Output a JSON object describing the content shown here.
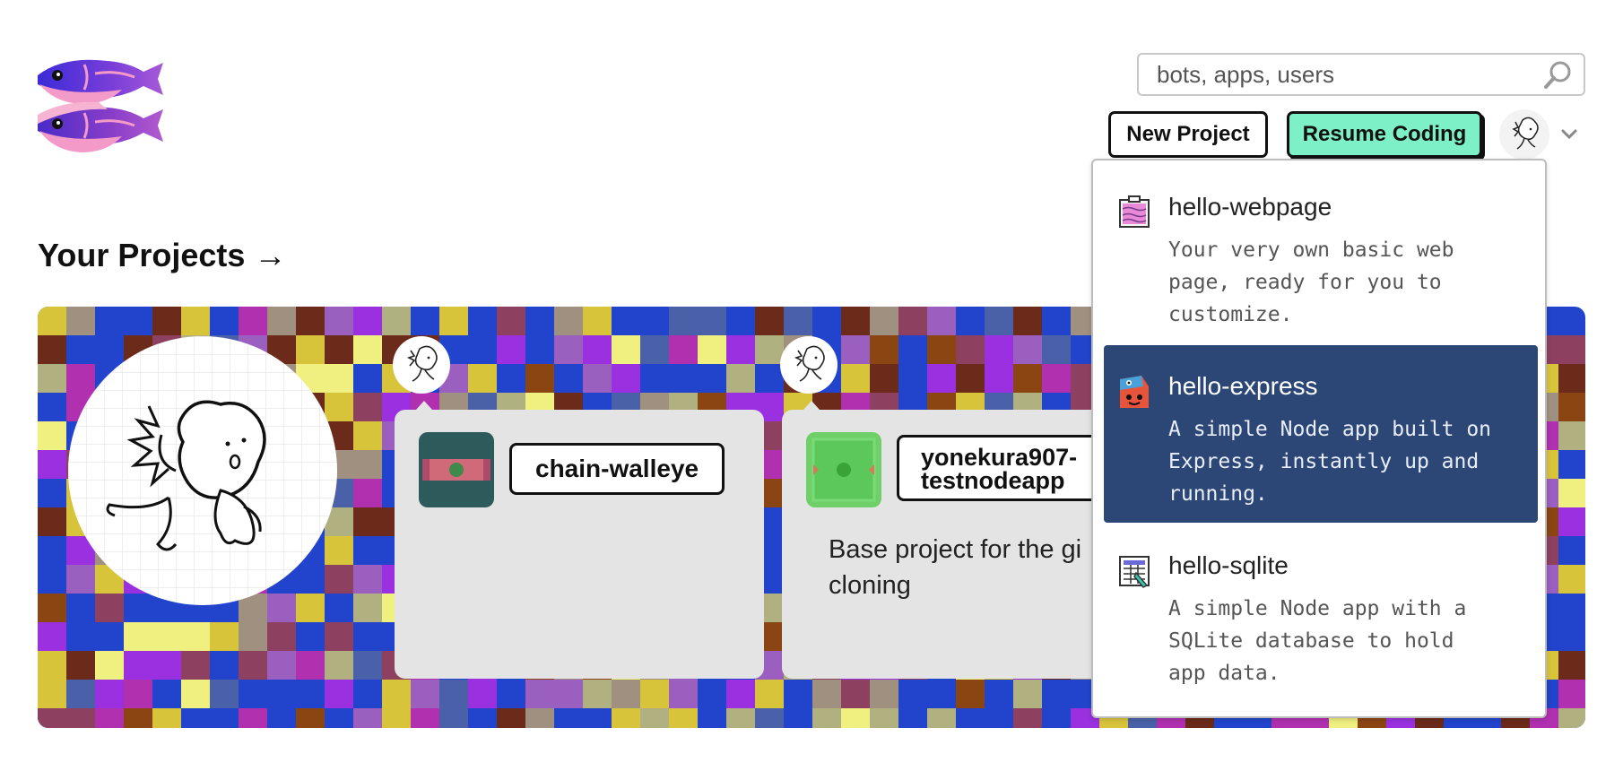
{
  "header": {
    "logo_icon": "glitch-fish-logo-icon",
    "search": {
      "placeholder": "bots, apps, users",
      "value": "",
      "icon": "search-icon"
    },
    "new_project_label": "New Project",
    "resume_coding_label": "Resume Coding",
    "user_avatar_icon": "user-avatar-icon",
    "menu_icon": "chevron-down-icon"
  },
  "main": {
    "heading": "Your Projects →",
    "projects": [
      {
        "name": "chain-walleye",
        "description": "",
        "icon": "project-avatar-icon",
        "icon_color": "#2d5b5b"
      },
      {
        "name": "yonekura907-testnodeapp",
        "name_lines": [
          "yonekura907-",
          "testnodeapp"
        ],
        "description": "Base project for the gi",
        "description_line2": "cloning",
        "icon": "project-avatar-icon",
        "icon_color": "#5cc75a"
      }
    ]
  },
  "new_project_menu": {
    "items": [
      {
        "name": "hello-webpage",
        "description": "Your very own basic web page, ready for you to customize.",
        "desc_lines": [
          "Your very own basic web",
          "page, ready for you to",
          "customize."
        ],
        "icon": "webpage-icon",
        "selected": false
      },
      {
        "name": "hello-express",
        "description": "A simple Node app built on Express, instantly up and running.",
        "desc_lines": [
          "A simple Node app built on",
          "Express, instantly up and",
          "running."
        ],
        "icon": "express-icon",
        "selected": true
      },
      {
        "name": "hello-sqlite",
        "description": "A simple Node app with a SQLite database to hold app data.",
        "desc_lines": [
          "A simple Node app with a",
          "SQLite database to hold",
          "app data."
        ],
        "icon": "sqlite-icon",
        "selected": false
      }
    ]
  },
  "colors": {
    "accent_button": "#7ef0c8",
    "banner_background": "#2244cc",
    "menu_selected": "#2c4675",
    "card_background": "#e4e4e4"
  }
}
